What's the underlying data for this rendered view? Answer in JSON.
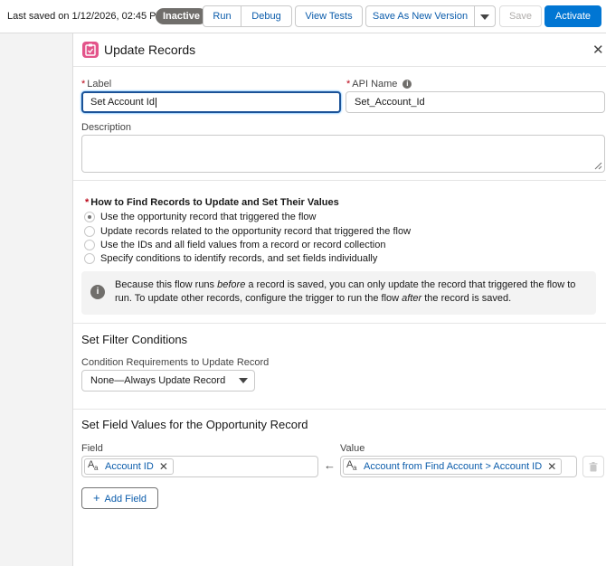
{
  "toolbar": {
    "last_saved": "Last saved on 1/12/2026, 02:45 PM",
    "status_badge": "Inactive",
    "run_label": "Run",
    "debug_label": "Debug",
    "view_tests_label": "View Tests",
    "save_as_new_label": "Save As New Version",
    "save_label": "Save",
    "activate_label": "Activate"
  },
  "panel": {
    "title": "Update Records",
    "label_field": {
      "label": "Label",
      "value": "Set Account Id"
    },
    "api_name_field": {
      "label": "API Name",
      "value": "Set_Account_Id"
    },
    "description_label": "Description",
    "find_records": {
      "label": "How to Find Records to Update and Set Their Values",
      "options": [
        {
          "text": "Use the opportunity record that triggered the flow",
          "checked": true
        },
        {
          "text": "Update records related to the opportunity record that triggered the flow",
          "checked": false
        },
        {
          "text": "Use the IDs and all field values from a record or record collection",
          "checked": false
        },
        {
          "text": "Specify conditions to identify records, and set fields individually",
          "checked": false
        }
      ],
      "info_parts": {
        "p1": "Because this flow runs ",
        "em1": "before",
        "p2": " a record is saved, you can only update the record that triggered the flow to run. To update other records, configure the trigger to run the flow ",
        "em2": "after",
        "p3": " the record is saved."
      }
    },
    "filter": {
      "title": "Set Filter Conditions",
      "condition_label": "Condition Requirements to Update Record",
      "condition_value": "None—Always Update Record"
    },
    "field_values": {
      "title": "Set Field Values for the Opportunity Record",
      "field_col": "Field",
      "value_col": "Value",
      "row": {
        "field": "Account ID",
        "value": "Account from Find Account > Account ID"
      },
      "add_field_label": "Add Field"
    }
  }
}
